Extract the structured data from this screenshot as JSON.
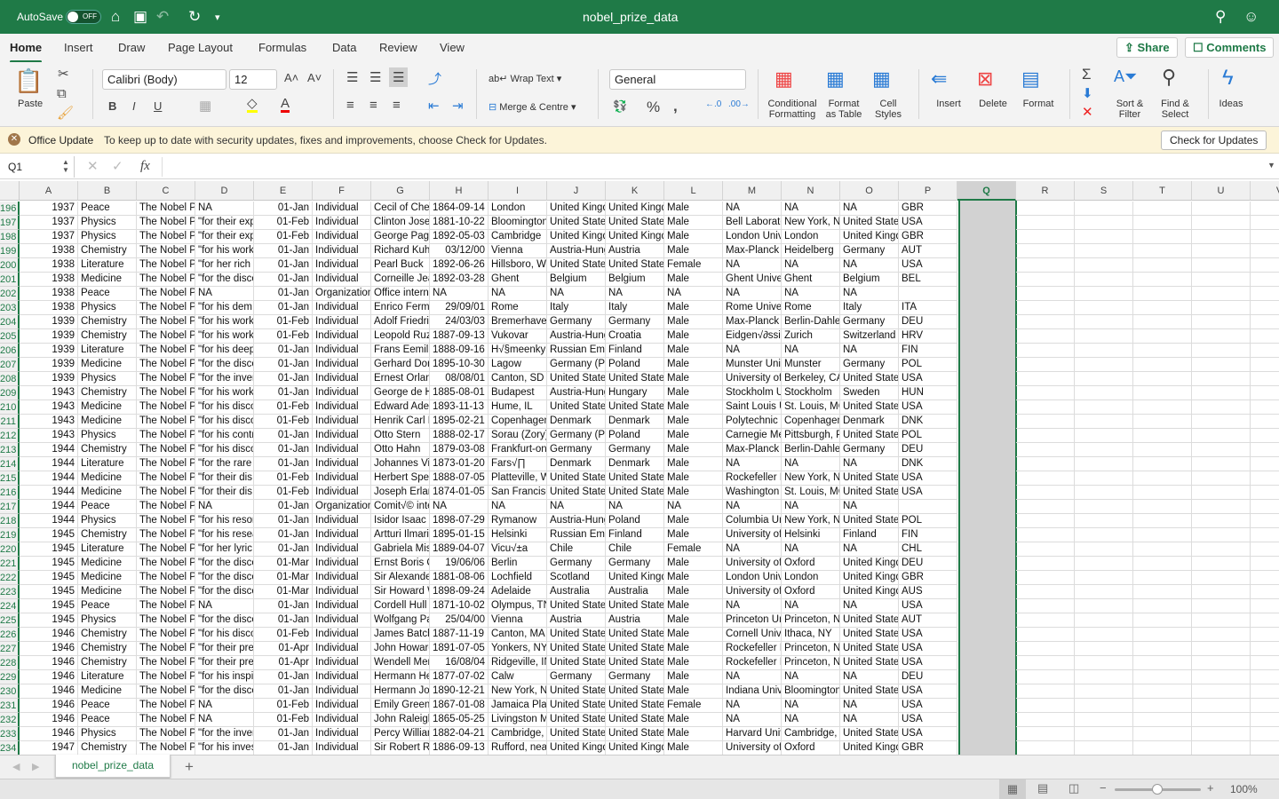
{
  "titlebar": {
    "autosave": "AutoSave",
    "toggle": "OFF",
    "doc_title": "nobel_prize_data"
  },
  "tabs": [
    "Home",
    "Insert",
    "Draw",
    "Page Layout",
    "Formulas",
    "Data",
    "Review",
    "View"
  ],
  "share": "Share",
  "comments": "Comments",
  "ribbon": {
    "paste": "Paste",
    "font": "Calibri (Body)",
    "size": "12",
    "wrap": "Wrap Text",
    "merge": "Merge & Centre",
    "number_format": "General",
    "cond": [
      "Conditional",
      "Formatting"
    ],
    "fmt_table": [
      "Format",
      "as Table"
    ],
    "cell_styles": [
      "Cell",
      "Styles"
    ],
    "insert": "Insert",
    "delete": "Delete",
    "format": "Format",
    "sort": [
      "Sort &",
      "Filter"
    ],
    "find": [
      "Find &",
      "Select"
    ],
    "ideas": "Ideas"
  },
  "update": {
    "title": "Office Update",
    "message": "To keep up to date with security updates, fixes and improvements, choose Check for Updates.",
    "button": "Check for Updates"
  },
  "formula": {
    "name_box": "Q1",
    "fx": "fx",
    "value": ""
  },
  "columns": [
    "A",
    "B",
    "C",
    "D",
    "E",
    "F",
    "G",
    "H",
    "I",
    "J",
    "K",
    "L",
    "M",
    "N",
    "O",
    "P",
    "Q",
    "R",
    "S",
    "T",
    "U",
    "V"
  ],
  "selected_column": "Q",
  "rows": [
    {
      "n": "196",
      "c": [
        "1937",
        "Peace",
        "The Nobel Pe",
        "NA",
        "01-Jan",
        "Individual",
        "Cecil of Chelv",
        "1864-09-14",
        "London",
        "United Kingd",
        "United Kingd",
        "Male",
        "NA",
        "NA",
        "NA",
        "GBR"
      ]
    },
    {
      "n": "197",
      "c": [
        "1937",
        "Physics",
        "The Nobel Pr",
        "\"for their exp",
        "01-Feb",
        "Individual",
        "Clinton Josep",
        "1881-10-22",
        "Bloomington",
        "United State",
        "United State",
        "Male",
        "Bell Laborato",
        "New York, N'",
        "United State",
        "USA"
      ]
    },
    {
      "n": "198",
      "c": [
        "1937",
        "Physics",
        "The Nobel Pr",
        "\"for their exp",
        "01-Feb",
        "Individual",
        "George Page",
        "1892-05-03",
        "Cambridge",
        "United Kingd",
        "United Kingd",
        "Male",
        "London Unive",
        "London",
        "United Kingd",
        "GBR"
      ]
    },
    {
      "n": "199",
      "c": [
        "1938",
        "Chemistry",
        "The Nobel Pr",
        "\"for his work",
        "01-Jan",
        "Individual",
        "Richard Kuhn",
        "03/12/00",
        "Vienna",
        "Austria-Hung",
        "Austria",
        "Male",
        "Max-Planck I",
        "Heidelberg",
        "Germany",
        "AUT"
      ]
    },
    {
      "n": "200",
      "c": [
        "1938",
        "Literature",
        "The Nobel Pr",
        "\"for her rich",
        "01-Jan",
        "Individual",
        "Pearl Buck",
        "1892-06-26",
        "Hillsboro, WV",
        "United State",
        "United State",
        "Female",
        "NA",
        "NA",
        "NA",
        "USA"
      ]
    },
    {
      "n": "201",
      "c": [
        "1938",
        "Medicine",
        "The Nobel Pr",
        "\"for the disco",
        "01-Jan",
        "Individual",
        "Corneille Jea",
        "1892-03-28",
        "Ghent",
        "Belgium",
        "Belgium",
        "Male",
        "Ghent Univer",
        "Ghent",
        "Belgium",
        "BEL"
      ]
    },
    {
      "n": "202",
      "c": [
        "1938",
        "Peace",
        "The Nobel Pe",
        "NA",
        "01-Jan",
        "Organization",
        "Office intern",
        "NA",
        "NA",
        "NA",
        "NA",
        "NA",
        "NA",
        "NA",
        "NA",
        ""
      ]
    },
    {
      "n": "203",
      "c": [
        "1938",
        "Physics",
        "The Nobel Pr",
        "\"for his dem",
        "01-Jan",
        "Individual",
        "Enrico Fermi",
        "29/09/01",
        "Rome",
        "Italy",
        "Italy",
        "Male",
        "Rome Univer",
        "Rome",
        "Italy",
        "ITA"
      ]
    },
    {
      "n": "204",
      "c": [
        "1939",
        "Chemistry",
        "The Nobel Pr",
        "\"for his work",
        "01-Feb",
        "Individual",
        "Adolf Friedric",
        "24/03/03",
        "Bremerhaven",
        "Germany",
        "Germany",
        "Male",
        "Max-Planck I",
        "Berlin-Dahlen",
        "Germany",
        "DEU"
      ]
    },
    {
      "n": "205",
      "c": [
        "1939",
        "Chemistry",
        "The Nobel Pr",
        "\"for his work",
        "01-Feb",
        "Individual",
        "Leopold Ruzi",
        "1887-09-13",
        "Vukovar",
        "Austria-Hung",
        "Croatia",
        "Male",
        "Eidgen√∂ssis",
        "Zurich",
        "Switzerland",
        "HRV"
      ]
    },
    {
      "n": "206",
      "c": [
        "1939",
        "Literature",
        "The Nobel Pr",
        "\"for his deep",
        "01-Jan",
        "Individual",
        "Frans Eemil S",
        "1888-09-16",
        "H√§meenkyr",
        "Russian Emp",
        "Finland",
        "Male",
        "NA",
        "NA",
        "NA",
        "FIN"
      ]
    },
    {
      "n": "207",
      "c": [
        "1939",
        "Medicine",
        "The Nobel Pr",
        "\"for the disco",
        "01-Jan",
        "Individual",
        "Gerhard Dom",
        "1895-10-30",
        "Lagow",
        "Germany (Po",
        "Poland",
        "Male",
        "Munster Univ",
        "Munster",
        "Germany",
        "POL"
      ]
    },
    {
      "n": "208",
      "c": [
        "1939",
        "Physics",
        "The Nobel Pr",
        "\"for the inven",
        "01-Jan",
        "Individual",
        "Ernest Orland",
        "08/08/01",
        "Canton, SD",
        "United State",
        "United State",
        "Male",
        "University of",
        "Berkeley, CA",
        "United State",
        "USA"
      ]
    },
    {
      "n": "209",
      "c": [
        "1943",
        "Chemistry",
        "The Nobel Pr",
        "\"for his work",
        "01-Jan",
        "Individual",
        "George de He",
        "1885-08-01",
        "Budapest",
        "Austria-Hung",
        "Hungary",
        "Male",
        "Stockholm U",
        "Stockholm",
        "Sweden",
        "HUN"
      ]
    },
    {
      "n": "210",
      "c": [
        "1943",
        "Medicine",
        "The Nobel Pr",
        "\"for his disco",
        "01-Feb",
        "Individual",
        "Edward Adel",
        "1893-11-13",
        "Hume, IL",
        "United State",
        "United State",
        "Male",
        "Saint Louis U",
        "St. Louis, MO",
        "United State",
        "USA"
      ]
    },
    {
      "n": "211",
      "c": [
        "1943",
        "Medicine",
        "The Nobel Pr",
        "\"for his disco",
        "01-Feb",
        "Individual",
        "Henrik Carl P",
        "1895-02-21",
        "Copenhagen",
        "Denmark",
        "Denmark",
        "Male",
        "Polytechnic I",
        "Copenhagen",
        "Denmark",
        "DNK"
      ]
    },
    {
      "n": "212",
      "c": [
        "1943",
        "Physics",
        "The Nobel Pr",
        "\"for his contr",
        "01-Jan",
        "Individual",
        "Otto Stern",
        "1888-02-17",
        "Sorau (Zory)",
        "Germany (Po",
        "Poland",
        "Male",
        "Carnegie Me",
        "Pittsburgh, P",
        "United State",
        "POL"
      ]
    },
    {
      "n": "213",
      "c": [
        "1944",
        "Chemistry",
        "The Nobel Pr",
        "\"for his disco",
        "01-Jan",
        "Individual",
        "Otto Hahn",
        "1879-03-08",
        "Frankfurt-on-",
        "Germany",
        "Germany",
        "Male",
        "Max-Planck I",
        "Berlin-Dahlen",
        "Germany",
        "DEU"
      ]
    },
    {
      "n": "214",
      "c": [
        "1944",
        "Literature",
        "The Nobel Pr",
        "\"for the rare",
        "01-Jan",
        "Individual",
        "Johannes Vill",
        "1873-01-20",
        "Fars√∏",
        "Denmark",
        "Denmark",
        "Male",
        "NA",
        "NA",
        "NA",
        "DNK"
      ]
    },
    {
      "n": "215",
      "c": [
        "1944",
        "Medicine",
        "The Nobel Pr",
        "\"for their dis",
        "01-Feb",
        "Individual",
        "Herbert Spen",
        "1888-07-05",
        "Platteville, W",
        "United State",
        "United State",
        "Male",
        "Rockefeller I",
        "New York, N'",
        "United State",
        "USA"
      ]
    },
    {
      "n": "216",
      "c": [
        "1944",
        "Medicine",
        "The Nobel Pr",
        "\"for their dis",
        "01-Feb",
        "Individual",
        "Joseph Erlang",
        "1874-01-05",
        "San Francisco",
        "United State",
        "United State",
        "Male",
        "Washington",
        "St. Louis, MO",
        "United State",
        "USA"
      ]
    },
    {
      "n": "217",
      "c": [
        "1944",
        "Peace",
        "The Nobel Pe",
        "NA",
        "01-Jan",
        "Organization",
        "Comit√© inte",
        "NA",
        "NA",
        "NA",
        "NA",
        "NA",
        "NA",
        "NA",
        "NA",
        ""
      ]
    },
    {
      "n": "218",
      "c": [
        "1944",
        "Physics",
        "The Nobel Pr",
        "\"for his reson",
        "01-Jan",
        "Individual",
        "Isidor Isaac R",
        "1898-07-29",
        "Rymanow",
        "Austria-Hung",
        "Poland",
        "Male",
        "Columbia Un",
        "New York, N'",
        "United State",
        "POL"
      ]
    },
    {
      "n": "219",
      "c": [
        "1945",
        "Chemistry",
        "The Nobel Pr",
        "\"for his resea",
        "01-Jan",
        "Individual",
        "Artturi Ilmari",
        "1895-01-15",
        "Helsinki",
        "Russian Emp",
        "Finland",
        "Male",
        "University of",
        "Helsinki",
        "Finland",
        "FIN"
      ]
    },
    {
      "n": "220",
      "c": [
        "1945",
        "Literature",
        "The Nobel Pr",
        "\"for her lyric",
        "01-Jan",
        "Individual",
        "Gabriela Mis",
        "1889-04-07",
        "Vicu√±a",
        "Chile",
        "Chile",
        "Female",
        "NA",
        "NA",
        "NA",
        "CHL"
      ]
    },
    {
      "n": "221",
      "c": [
        "1945",
        "Medicine",
        "The Nobel Pr",
        "\"for the disco",
        "01-Mar",
        "Individual",
        "Ernst Boris C",
        "19/06/06",
        "Berlin",
        "Germany",
        "Germany",
        "Male",
        "University of",
        "Oxford",
        "United Kingd",
        "DEU"
      ]
    },
    {
      "n": "222",
      "c": [
        "1945",
        "Medicine",
        "The Nobel Pr",
        "\"for the disco",
        "01-Mar",
        "Individual",
        "Sir Alexander",
        "1881-08-06",
        "Lochfield",
        "Scotland",
        "United Kingd",
        "Male",
        "London Unive",
        "London",
        "United Kingd",
        "GBR"
      ]
    },
    {
      "n": "223",
      "c": [
        "1945",
        "Medicine",
        "The Nobel Pr",
        "\"for the disco",
        "01-Mar",
        "Individual",
        "Sir Howard W",
        "1898-09-24",
        "Adelaide",
        "Australia",
        "Australia",
        "Male",
        "University of",
        "Oxford",
        "United Kingd",
        "AUS"
      ]
    },
    {
      "n": "224",
      "c": [
        "1945",
        "Peace",
        "The Nobel Pe",
        "NA",
        "01-Jan",
        "Individual",
        "Cordell Hull",
        "1871-10-02",
        "Olympus, TN",
        "United State",
        "United State",
        "Male",
        "NA",
        "NA",
        "NA",
        "USA"
      ]
    },
    {
      "n": "225",
      "c": [
        "1945",
        "Physics",
        "The Nobel Pr",
        "\"for the disco",
        "01-Jan",
        "Individual",
        "Wolfgang Pa",
        "25/04/00",
        "Vienna",
        "Austria",
        "Austria",
        "Male",
        "Princeton Un",
        "Princeton, NJ",
        "United State",
        "AUT"
      ]
    },
    {
      "n": "226",
      "c": [
        "1946",
        "Chemistry",
        "The Nobel Pr",
        "\"for his disco",
        "01-Feb",
        "Individual",
        "James Batch",
        "1887-11-19",
        "Canton, MA",
        "United State",
        "United State",
        "Male",
        "Cornell Unive",
        "Ithaca, NY",
        "United State",
        "USA"
      ]
    },
    {
      "n": "227",
      "c": [
        "1946",
        "Chemistry",
        "The Nobel Pr",
        "\"for their pre",
        "01-Apr",
        "Individual",
        "John Howard",
        "1891-07-05",
        "Yonkers, NY",
        "United State",
        "United State",
        "Male",
        "Rockefeller I",
        "Princeton, NJ",
        "United State",
        "USA"
      ]
    },
    {
      "n": "228",
      "c": [
        "1946",
        "Chemistry",
        "The Nobel Pr",
        "\"for their pre",
        "01-Apr",
        "Individual",
        "Wendell Mer",
        "16/08/04",
        "Ridgeville, IN",
        "United State",
        "United State",
        "Male",
        "Rockefeller I",
        "Princeton, NJ",
        "United State",
        "USA"
      ]
    },
    {
      "n": "229",
      "c": [
        "1946",
        "Literature",
        "The Nobel Pr",
        "\"for his inspi",
        "01-Jan",
        "Individual",
        "Hermann Hes",
        "1877-07-02",
        "Calw",
        "Germany",
        "Germany",
        "Male",
        "NA",
        "NA",
        "NA",
        "DEU"
      ]
    },
    {
      "n": "230",
      "c": [
        "1946",
        "Medicine",
        "The Nobel Pr",
        "\"for the disco",
        "01-Jan",
        "Individual",
        "Hermann Jos",
        "1890-12-21",
        "New York, N'",
        "United State",
        "United State",
        "Male",
        "Indiana Univ",
        "Bloomington",
        "United State",
        "USA"
      ]
    },
    {
      "n": "231",
      "c": [
        "1946",
        "Peace",
        "The Nobel Pe",
        "NA",
        "01-Feb",
        "Individual",
        "Emily Greene",
        "1867-01-08",
        "Jamaica Plain",
        "United State",
        "United State",
        "Female",
        "NA",
        "NA",
        "NA",
        "USA"
      ]
    },
    {
      "n": "232",
      "c": [
        "1946",
        "Peace",
        "The Nobel Pe",
        "NA",
        "01-Feb",
        "Individual",
        "John Raleigh",
        "1865-05-25",
        "Livingston M",
        "United State",
        "United State",
        "Male",
        "NA",
        "NA",
        "NA",
        "USA"
      ]
    },
    {
      "n": "233",
      "c": [
        "1946",
        "Physics",
        "The Nobel Pr",
        "\"for the inven",
        "01-Jan",
        "Individual",
        "Percy Willian",
        "1882-04-21",
        "Cambridge, M",
        "United State",
        "United State",
        "Male",
        "Harvard Univ",
        "Cambridge, M",
        "United State",
        "USA"
      ]
    },
    {
      "n": "234",
      "c": [
        "1947",
        "Chemistry",
        "The Nobel Pr",
        "\"for his inves",
        "01-Jan",
        "Individual",
        "Sir Robert Ro",
        "1886-09-13",
        "Rufford, near",
        "United Kingd",
        "United Kingd",
        "Male",
        "University of",
        "Oxford",
        "United Kingd",
        "GBR"
      ]
    }
  ],
  "sheet_tab": "nobel_prize_data",
  "add_sheet": "+",
  "status": {
    "zoom": "100%"
  },
  "colors": {
    "brand": "#1f7a47",
    "update_bg": "#fcf4d9"
  }
}
